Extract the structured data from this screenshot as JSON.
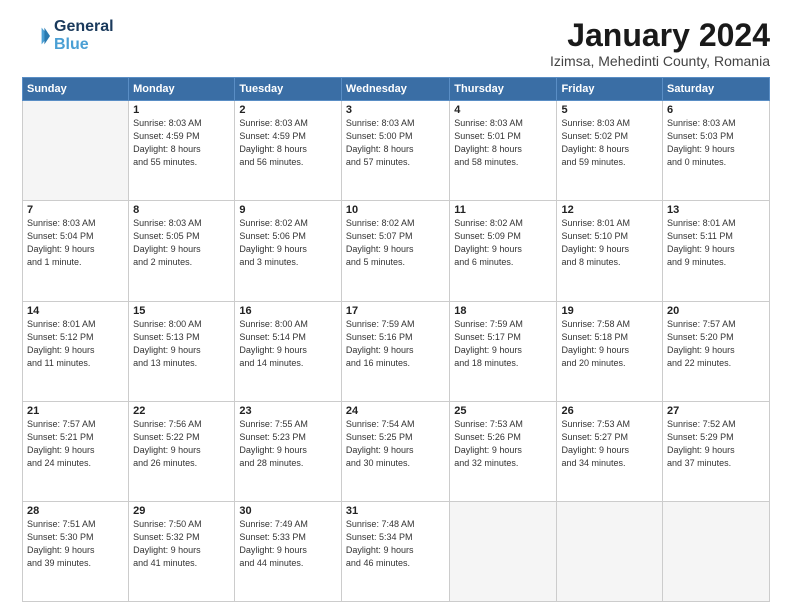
{
  "logo": {
    "line1": "General",
    "line2": "Blue"
  },
  "title": "January 2024",
  "location": "Izimsa, Mehedinti County, Romania",
  "days_header": [
    "Sunday",
    "Monday",
    "Tuesday",
    "Wednesday",
    "Thursday",
    "Friday",
    "Saturday"
  ],
  "weeks": [
    [
      {
        "day": "",
        "info": ""
      },
      {
        "day": "1",
        "info": "Sunrise: 8:03 AM\nSunset: 4:59 PM\nDaylight: 8 hours\nand 55 minutes."
      },
      {
        "day": "2",
        "info": "Sunrise: 8:03 AM\nSunset: 4:59 PM\nDaylight: 8 hours\nand 56 minutes."
      },
      {
        "day": "3",
        "info": "Sunrise: 8:03 AM\nSunset: 5:00 PM\nDaylight: 8 hours\nand 57 minutes."
      },
      {
        "day": "4",
        "info": "Sunrise: 8:03 AM\nSunset: 5:01 PM\nDaylight: 8 hours\nand 58 minutes."
      },
      {
        "day": "5",
        "info": "Sunrise: 8:03 AM\nSunset: 5:02 PM\nDaylight: 8 hours\nand 59 minutes."
      },
      {
        "day": "6",
        "info": "Sunrise: 8:03 AM\nSunset: 5:03 PM\nDaylight: 9 hours\nand 0 minutes."
      }
    ],
    [
      {
        "day": "7",
        "info": "Sunrise: 8:03 AM\nSunset: 5:04 PM\nDaylight: 9 hours\nand 1 minute."
      },
      {
        "day": "8",
        "info": "Sunrise: 8:03 AM\nSunset: 5:05 PM\nDaylight: 9 hours\nand 2 minutes."
      },
      {
        "day": "9",
        "info": "Sunrise: 8:02 AM\nSunset: 5:06 PM\nDaylight: 9 hours\nand 3 minutes."
      },
      {
        "day": "10",
        "info": "Sunrise: 8:02 AM\nSunset: 5:07 PM\nDaylight: 9 hours\nand 5 minutes."
      },
      {
        "day": "11",
        "info": "Sunrise: 8:02 AM\nSunset: 5:09 PM\nDaylight: 9 hours\nand 6 minutes."
      },
      {
        "day": "12",
        "info": "Sunrise: 8:01 AM\nSunset: 5:10 PM\nDaylight: 9 hours\nand 8 minutes."
      },
      {
        "day": "13",
        "info": "Sunrise: 8:01 AM\nSunset: 5:11 PM\nDaylight: 9 hours\nand 9 minutes."
      }
    ],
    [
      {
        "day": "14",
        "info": "Sunrise: 8:01 AM\nSunset: 5:12 PM\nDaylight: 9 hours\nand 11 minutes."
      },
      {
        "day": "15",
        "info": "Sunrise: 8:00 AM\nSunset: 5:13 PM\nDaylight: 9 hours\nand 13 minutes."
      },
      {
        "day": "16",
        "info": "Sunrise: 8:00 AM\nSunset: 5:14 PM\nDaylight: 9 hours\nand 14 minutes."
      },
      {
        "day": "17",
        "info": "Sunrise: 7:59 AM\nSunset: 5:16 PM\nDaylight: 9 hours\nand 16 minutes."
      },
      {
        "day": "18",
        "info": "Sunrise: 7:59 AM\nSunset: 5:17 PM\nDaylight: 9 hours\nand 18 minutes."
      },
      {
        "day": "19",
        "info": "Sunrise: 7:58 AM\nSunset: 5:18 PM\nDaylight: 9 hours\nand 20 minutes."
      },
      {
        "day": "20",
        "info": "Sunrise: 7:57 AM\nSunset: 5:20 PM\nDaylight: 9 hours\nand 22 minutes."
      }
    ],
    [
      {
        "day": "21",
        "info": "Sunrise: 7:57 AM\nSunset: 5:21 PM\nDaylight: 9 hours\nand 24 minutes."
      },
      {
        "day": "22",
        "info": "Sunrise: 7:56 AM\nSunset: 5:22 PM\nDaylight: 9 hours\nand 26 minutes."
      },
      {
        "day": "23",
        "info": "Sunrise: 7:55 AM\nSunset: 5:23 PM\nDaylight: 9 hours\nand 28 minutes."
      },
      {
        "day": "24",
        "info": "Sunrise: 7:54 AM\nSunset: 5:25 PM\nDaylight: 9 hours\nand 30 minutes."
      },
      {
        "day": "25",
        "info": "Sunrise: 7:53 AM\nSunset: 5:26 PM\nDaylight: 9 hours\nand 32 minutes."
      },
      {
        "day": "26",
        "info": "Sunrise: 7:53 AM\nSunset: 5:27 PM\nDaylight: 9 hours\nand 34 minutes."
      },
      {
        "day": "27",
        "info": "Sunrise: 7:52 AM\nSunset: 5:29 PM\nDaylight: 9 hours\nand 37 minutes."
      }
    ],
    [
      {
        "day": "28",
        "info": "Sunrise: 7:51 AM\nSunset: 5:30 PM\nDaylight: 9 hours\nand 39 minutes."
      },
      {
        "day": "29",
        "info": "Sunrise: 7:50 AM\nSunset: 5:32 PM\nDaylight: 9 hours\nand 41 minutes."
      },
      {
        "day": "30",
        "info": "Sunrise: 7:49 AM\nSunset: 5:33 PM\nDaylight: 9 hours\nand 44 minutes."
      },
      {
        "day": "31",
        "info": "Sunrise: 7:48 AM\nSunset: 5:34 PM\nDaylight: 9 hours\nand 46 minutes."
      },
      {
        "day": "",
        "info": ""
      },
      {
        "day": "",
        "info": ""
      },
      {
        "day": "",
        "info": ""
      }
    ]
  ]
}
